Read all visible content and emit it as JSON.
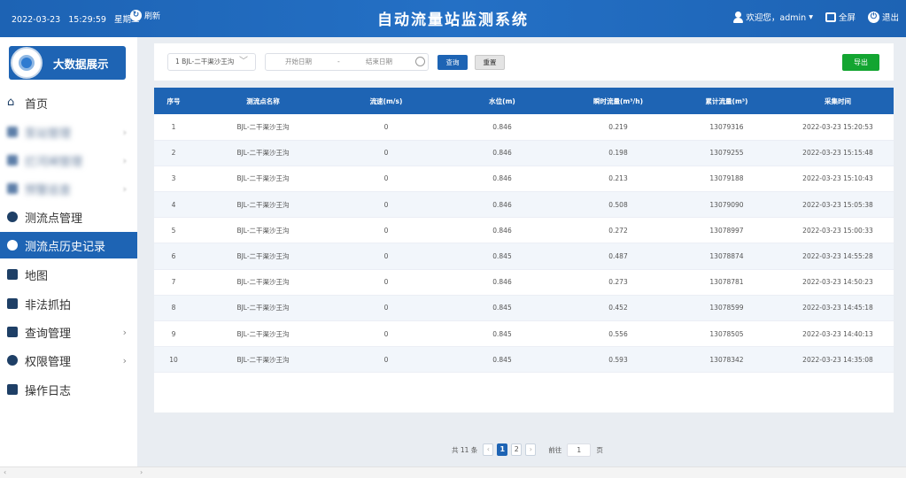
{
  "header": {
    "date": "2022-03-23",
    "time": "15:29:59",
    "weekday": "星期三",
    "refresh_label": "刷新",
    "title": "自动流量站监测系统",
    "welcome": "欢迎您，admin",
    "fullscreen_label": "全屏",
    "logout_label": "退出"
  },
  "sidebar": {
    "bigdata_label": "大数据展示",
    "items": [
      {
        "label": "首页",
        "icon": "home-icon",
        "blurred": false,
        "arrow": false
      },
      {
        "label": "泵站管理",
        "icon": "pump-icon",
        "blurred": true,
        "arrow": true
      },
      {
        "label": "拦河闸管理",
        "icon": "gate-icon",
        "blurred": true,
        "arrow": true
      },
      {
        "label": "预警巡查",
        "icon": "alert-icon",
        "blurred": true,
        "arrow": true
      },
      {
        "label": "测流点管理",
        "icon": "circle-icon",
        "blurred": false,
        "arrow": false
      },
      {
        "label": "测流点历史记录",
        "icon": "circle-icon",
        "blurred": false,
        "arrow": false,
        "active": true
      },
      {
        "label": "地图",
        "icon": "map-icon",
        "blurred": false,
        "arrow": false
      },
      {
        "label": "非法抓拍",
        "icon": "camera-icon",
        "blurred": false,
        "arrow": false
      },
      {
        "label": "查询管理",
        "icon": "query-icon",
        "blurred": false,
        "arrow": true
      },
      {
        "label": "权限管理",
        "icon": "shield-icon",
        "blurred": false,
        "arrow": true
      },
      {
        "label": "操作日志",
        "icon": "log-icon",
        "blurred": false,
        "arrow": false
      }
    ],
    "arrow_glyph": "›"
  },
  "filter": {
    "station_value": "1 BJL-二干渠沙王沟",
    "start_placeholder": "开始日期",
    "range_sep": "-",
    "end_placeholder": "结束日期",
    "query_label": "查询",
    "reset_label": "重置",
    "export_label": "导出"
  },
  "table": {
    "columns": [
      "序号",
      "测流点名称",
      "流速(m/s)",
      "水位(m)",
      "瞬时流量(m³/h)",
      "累计流量(m³)",
      "采集时间"
    ],
    "rows": [
      [
        "1",
        "BJL-二干渠沙王沟",
        "0",
        "0.846",
        "0.219",
        "13079316",
        "2022-03-23 15:20:53"
      ],
      [
        "2",
        "BJL-二干渠沙王沟",
        "0",
        "0.846",
        "0.198",
        "13079255",
        "2022-03-23 15:15:48"
      ],
      [
        "3",
        "BJL-二干渠沙王沟",
        "0",
        "0.846",
        "0.213",
        "13079188",
        "2022-03-23 15:10:43"
      ],
      [
        "4",
        "BJL-二干渠沙王沟",
        "0",
        "0.846",
        "0.508",
        "13079090",
        "2022-03-23 15:05:38"
      ],
      [
        "5",
        "BJL-二干渠沙王沟",
        "0",
        "0.846",
        "0.272",
        "13078997",
        "2022-03-23 15:00:33"
      ],
      [
        "6",
        "BJL-二干渠沙王沟",
        "0",
        "0.845",
        "0.487",
        "13078874",
        "2022-03-23 14:55:28"
      ],
      [
        "7",
        "BJL-二干渠沙王沟",
        "0",
        "0.846",
        "0.273",
        "13078781",
        "2022-03-23 14:50:23"
      ],
      [
        "8",
        "BJL-二干渠沙王沟",
        "0",
        "0.845",
        "0.452",
        "13078599",
        "2022-03-23 14:45:18"
      ],
      [
        "9",
        "BJL-二干渠沙王沟",
        "0",
        "0.845",
        "0.556",
        "13078505",
        "2022-03-23 14:40:13"
      ],
      [
        "10",
        "BJL-二干渠沙王沟",
        "0",
        "0.845",
        "0.593",
        "13078342",
        "2022-03-23 14:35:08"
      ]
    ]
  },
  "pagination": {
    "total_text": "共 11 条",
    "prev": "‹",
    "pages": [
      "1",
      "2"
    ],
    "current": "1",
    "next": "›",
    "goto_label": "前往",
    "goto_value": "1",
    "page_unit": "页"
  },
  "colors": {
    "brand": "#1e64b4",
    "export_green": "#13a531",
    "row_stripe": "#f2f6fb"
  }
}
